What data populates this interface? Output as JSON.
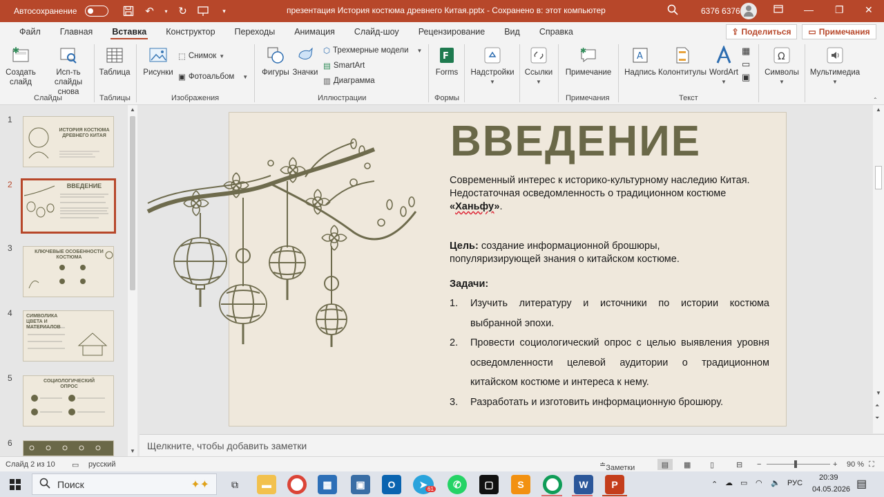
{
  "titlebar": {
    "autosave_label": "Автосохранение",
    "autosave_state": "off",
    "document_title": "презентация История костюма древнего Китая.pptx  -  Сохранено в: этот компьютер",
    "user_name": "6376 6376"
  },
  "ribbon_tabs": [
    "Файл",
    "Главная",
    "Вставка",
    "Конструктор",
    "Переходы",
    "Анимация",
    "Слайд-шоу",
    "Рецензирование",
    "Вид",
    "Справка"
  ],
  "active_tab": "Вставка",
  "share_label": "Поделиться",
  "comments_label": "Примечания",
  "ribbon": {
    "new_slide": "Создать слайд",
    "reuse_slides": "Исп-ть слайды снова",
    "table": "Таблица",
    "pictures": "Рисунки",
    "screenshot": "Снимок",
    "photo_album": "Фотоальбом",
    "shapes": "Фигуры",
    "icons": "Значки",
    "models_3d": "Трехмерные модели",
    "smartart": "SmartArt",
    "chart": "Диаграмма",
    "forms": "Forms",
    "addins": "Надстройки",
    "links": "Ссылки",
    "comment": "Примечание",
    "textbox": "Надпись",
    "header_footer": "Колонтитулы",
    "wordart": "WordArt",
    "symbols": "Символы",
    "media": "Мультимедиа",
    "groups": {
      "slides": "Слайды",
      "tables": "Таблицы",
      "images": "Изображения",
      "illustrations": "Иллюстрации",
      "forms": "Формы",
      "comments": "Примечания",
      "text": "Текст"
    }
  },
  "thumbnails": {
    "numbers": [
      "1",
      "2",
      "3",
      "4",
      "5",
      "6"
    ],
    "titles": [
      "ИСТОРИЯ КОСТЮМА ДРЕВНЕГО КИТАЯ",
      "ВВЕДЕНИЕ",
      "КЛЮЧЕВЫЕ ОСОБЕННОСТИ КОСТЮМА",
      "СИМВОЛИКА ЦВЕТА И МАТЕРИАЛОВ",
      "СОЦИОЛОГИЧЕСКИЙ ОПРОС",
      ""
    ],
    "active_index": 1
  },
  "slide": {
    "title": "ВВЕДЕНИЕ",
    "intro_line1": "Современный интерес к историко-культурному наследию Китая.",
    "intro_line2_pre": "Недостаточная осведомленность о традиционном костюме ",
    "intro_line2_bold_open": "«",
    "intro_line2_bold_word": "Ханьфу",
    "intro_line2_bold_close": "»",
    "intro_line2_post": ".",
    "goal_label": "Цель:",
    "goal_text": " создание информационной брошюры, популяризирующей знания о китайском костюме.",
    "tasks_label": "Задачи:",
    "tasks": [
      {
        "num": "1.",
        "text": "Изучить литературу и источники по истории костюма выбранной эпохи."
      },
      {
        "num": "2.",
        "text": "Провести социологический опрос с целью выявления уровня осведомленности целевой аудитории о традиционном китайском костюме и интереса к нему."
      },
      {
        "num": "3.",
        "text": "Разработать и изготовить информационную брошюру."
      }
    ]
  },
  "notes_placeholder": "Щелкните, чтобы добавить заметки",
  "statusbar": {
    "slide_info": "Слайд 2 из 10",
    "language": "русский",
    "notes_label": "Заметки",
    "zoom": "90 %"
  },
  "taskbar": {
    "search_label": "Поиск",
    "lang": "РУС",
    "time": "20:39",
    "date": "04.05.2026",
    "telegram_badge": "61"
  },
  "colors": {
    "accent": "#b7472a",
    "slide_bg": "#efe8dc",
    "title_color": "#6a6848"
  }
}
